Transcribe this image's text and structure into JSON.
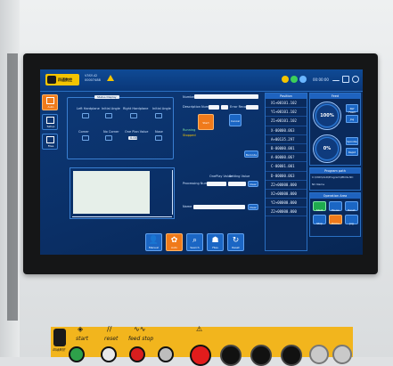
{
  "header": {
    "brand_text": "四通数控",
    "device_line1": "V3SY-42",
    "device_line2": "00007488",
    "clock": "00:00:00"
  },
  "sidebar": [
    {
      "label": "Auto",
      "icon": "auto-icon",
      "active": true
    },
    {
      "label": "Setup",
      "icon": "monitor-icon",
      "active": false
    },
    {
      "label": "Files",
      "icon": "file-icon",
      "active": false
    }
  ],
  "status_panel": {
    "tab": "Status Display",
    "row1": [
      "Left Hardplane",
      "Initial Angle",
      "Right Hardplane",
      "Initial Angle"
    ],
    "row2": [
      "Corner",
      "No Corner",
      "One Plan Value",
      "Nose"
    ],
    "value_box": "0.00"
  },
  "form": {
    "number_label": "Number",
    "description_label": "Description Number",
    "error_label": "Error Record",
    "start_label": "Start",
    "cancel_label": "Cancel",
    "barcode_label": "Barcode",
    "status_label1": "Running",
    "status_label2": "Stopped",
    "oneplay_label": "OnePlay Value",
    "setting_label": "Setting Value",
    "processing_label": "Processing Number",
    "clear_label": "Clear",
    "name_label": "Name",
    "clear2_label": "Clear"
  },
  "coords": {
    "header": "Position",
    "rows": [
      "X1+00101.102",
      "Y1+00101.102",
      "Z1+00101.102",
      "X-00000.063",
      "A+00135.297",
      "B-00000.001",
      "A-00000.06?",
      "C-00001.001",
      "D-00000.063",
      "Z2+00000.000",
      "X2+00000.000",
      "Y2+00000.000",
      "Z2+00000.000"
    ]
  },
  "gauges": {
    "feed_head": "Feed",
    "feed_value": "100%",
    "spindle_value": "0%",
    "side_a": "Ref Feed",
    "side_b": "Jog",
    "side_c": "Spindle",
    "side_d": "Rapid",
    "program_head": "Program path",
    "program_path": "C:\\CNC\\OLD\\Program\\PROG.NC",
    "program_sub": "NC Name",
    "ops_head": "Operation Area",
    "ops": [
      "Start",
      "Pause",
      "Reset",
      "Stop",
      "Home",
      "Jog"
    ]
  },
  "bottom_bar": [
    {
      "label": "Manual",
      "glyph": "👤",
      "icon": "person-icon",
      "active": false
    },
    {
      "label": "Auto",
      "glyph": "✿",
      "icon": "auto-run-icon",
      "active": true
    },
    {
      "label": "Search",
      "glyph": "⌕",
      "icon": "search-icon",
      "active": false
    },
    {
      "label": "Files",
      "glyph": "☗",
      "icon": "files-icon",
      "active": false
    },
    {
      "label": "Reset",
      "glyph": "↻",
      "icon": "reset-icon",
      "active": false
    }
  ],
  "control_strip": {
    "start_label": "start",
    "reset_label": "reset",
    "feedstop_label": "feed stop",
    "brand_small": "四通数控"
  },
  "colors": {
    "screen_blue": "#0a2f66",
    "accent_orange": "#f07a1a",
    "panel_yellow": "#f2b51d"
  }
}
